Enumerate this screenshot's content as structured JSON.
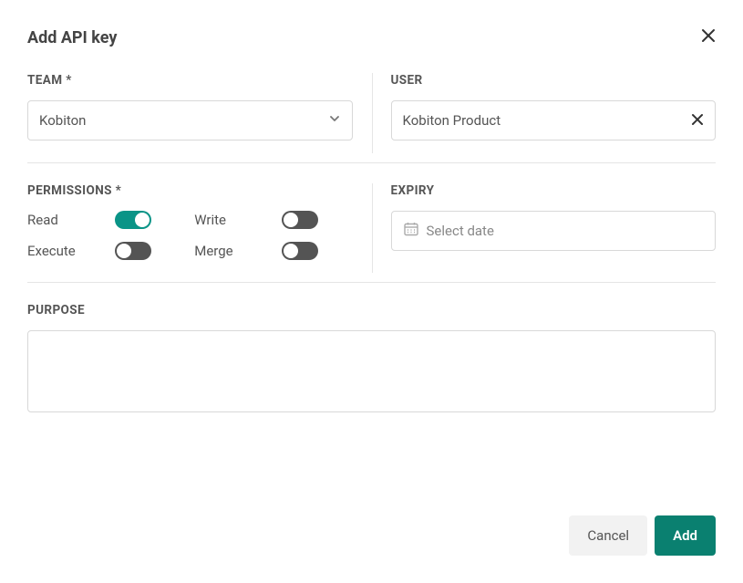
{
  "dialog_title": "Add API key",
  "team_section": {
    "label": "TEAM *",
    "value": "Kobiton"
  },
  "user_section": {
    "label": "USER",
    "value": "Kobiton Product"
  },
  "permissions_section": {
    "label": "PERMISSIONS *",
    "read": {
      "label": "Read",
      "on": true
    },
    "write": {
      "label": "Write",
      "on": false
    },
    "execute": {
      "label": "Execute",
      "on": false
    },
    "merge": {
      "label": "Merge",
      "on": false
    }
  },
  "expiry_section": {
    "label": "EXPIRY",
    "placeholder": "Select date"
  },
  "purpose_section": {
    "label": "PURPOSE",
    "value": ""
  },
  "footer": {
    "cancel": "Cancel",
    "add": "Add"
  }
}
